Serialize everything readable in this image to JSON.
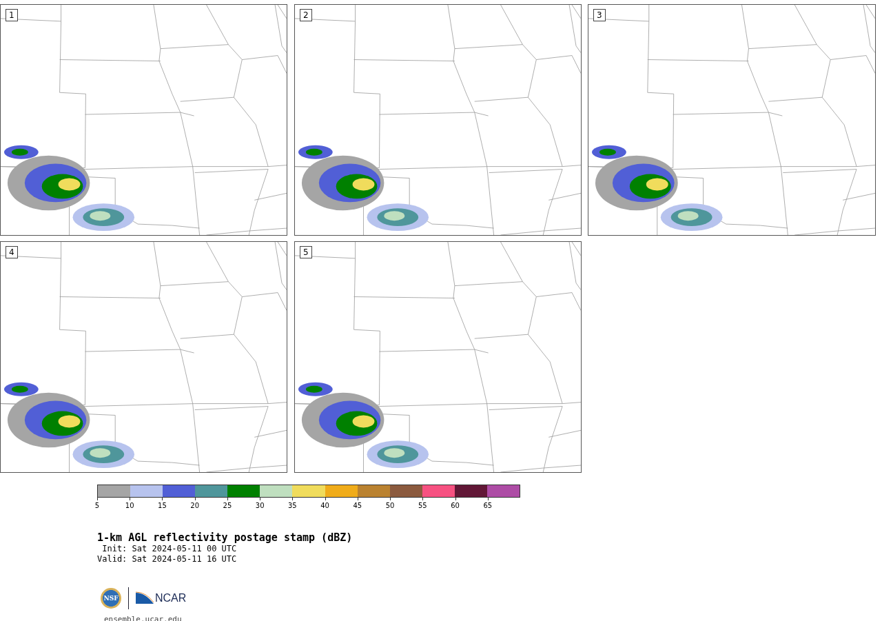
{
  "panels": [
    {
      "label": "1"
    },
    {
      "label": "2"
    },
    {
      "label": "3"
    },
    {
      "label": "4"
    },
    {
      "label": "5"
    }
  ],
  "colorbar": {
    "colors": [
      {
        "color": "#a5a5a5"
      },
      {
        "color": "#b7c3ee"
      },
      {
        "color": "#515fd6"
      },
      {
        "color": "#4f969b"
      },
      {
        "color": "#008000"
      },
      {
        "color": "#bfdfbf"
      },
      {
        "color": "#f0dc5c"
      },
      {
        "color": "#f0ac1a"
      },
      {
        "color": "#ba8230"
      },
      {
        "color": "#8b5a3e"
      },
      {
        "color": "#f65181"
      },
      {
        "color": "#611736"
      },
      {
        "color": "#ad4ca5"
      }
    ],
    "ticks": [
      "5",
      "10",
      "15",
      "20",
      "25",
      "30",
      "35",
      "40",
      "45",
      "50",
      "55",
      "60",
      "65"
    ]
  },
  "title": "1-km AGL reflectivity postage stamp (dBZ)",
  "init": " Init: Sat 2024-05-11 00 UTC",
  "valid": "Valid: Sat 2024-05-11 16 UTC",
  "logos": {
    "nsf": "NSF",
    "ncar": "NCAR"
  },
  "site_link": "ensemble.ucar.edu"
}
